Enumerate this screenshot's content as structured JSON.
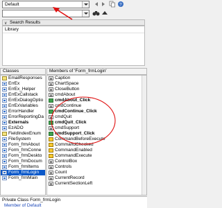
{
  "toolbar": {
    "library_combo_value": "Default",
    "search_combo_value": "",
    "icons": [
      "chevron-left-icon",
      "chevron-right-icon",
      "copy-icon",
      "help-icon",
      "binoculars-icon",
      "collapse-up-icon"
    ]
  },
  "search_results": {
    "title": "Search Results",
    "column_header": "Library"
  },
  "classes_panel": {
    "title": "Classes",
    "items": [
      {
        "label": "EmailResponses",
        "icon": "class-icon"
      },
      {
        "label": "ErrEx",
        "icon": "module-icon"
      },
      {
        "label": "ErrEx_Helper",
        "icon": "module-icon"
      },
      {
        "label": "ErrExCallstack",
        "icon": "module-icon"
      },
      {
        "label": "ErrExDialogOptio",
        "icon": "module-icon"
      },
      {
        "label": "ErrExVariables",
        "icon": "module-icon"
      },
      {
        "label": "ErrorHandler",
        "icon": "module-icon"
      },
      {
        "label": "ErrorReportingDa",
        "icon": "module-icon"
      },
      {
        "label": "Externals",
        "icon": "module-icon",
        "bold": true
      },
      {
        "label": "EzADO",
        "icon": "module-icon"
      },
      {
        "label": "FieldIndexEnum",
        "icon": "enum-icon"
      },
      {
        "label": "FileSystem",
        "icon": "module-icon"
      },
      {
        "label": "Form_frmAbout",
        "icon": "module-icon"
      },
      {
        "label": "Form_frmConne",
        "icon": "module-icon"
      },
      {
        "label": "Form_frmDeskto",
        "icon": "module-icon"
      },
      {
        "label": "Form_frmDocum",
        "icon": "module-icon"
      },
      {
        "label": "Form_frmItems",
        "icon": "module-icon"
      },
      {
        "label": "Form_frmLogin",
        "icon": "module-icon",
        "selected": true
      },
      {
        "label": "Form_frmMain",
        "icon": "module-icon"
      }
    ]
  },
  "members_panel": {
    "title": "Members of 'Form_frmLogin'",
    "items": [
      {
        "label": "Caption",
        "icon": "property-icon"
      },
      {
        "label": "ChartSpace",
        "icon": "property-icon"
      },
      {
        "label": "CloseButton",
        "icon": "property-icon"
      },
      {
        "label": "cmdAbout",
        "icon": "property-icon"
      },
      {
        "label": "cmdAbout_Click",
        "icon": "method-icon",
        "bold": true
      },
      {
        "label": "cmdContinue",
        "icon": "property-icon"
      },
      {
        "label": "cmdContinue_Click",
        "icon": "method-icon",
        "bold": true
      },
      {
        "label": "cmdQuit",
        "icon": "property-icon"
      },
      {
        "label": "cmdQuit_Click",
        "icon": "method-icon",
        "bold": true
      },
      {
        "label": "cmdSupport",
        "icon": "property-icon"
      },
      {
        "label": "cmdSupport_Click",
        "icon": "method-icon",
        "bold": true
      },
      {
        "label": "CommandBeforeExecute",
        "icon": "event-icon"
      },
      {
        "label": "CommandChecked",
        "icon": "event-icon"
      },
      {
        "label": "CommandEnabled",
        "icon": "event-icon"
      },
      {
        "label": "CommandExecute",
        "icon": "event-icon"
      },
      {
        "label": "ControlBox",
        "icon": "property-icon"
      },
      {
        "label": "Controls",
        "icon": "property-icon"
      },
      {
        "label": "Count",
        "icon": "property-icon"
      },
      {
        "label": "CurrentRecord",
        "icon": "property-icon"
      },
      {
        "label": "CurrentSectionLeft",
        "icon": "property-icon"
      }
    ]
  },
  "status_bar": {
    "line1": "Private Class Form_frmLogin",
    "line2": "Member of Default"
  },
  "annotations": {
    "arrow_color": "#e01010",
    "highlight_color": "#e01010"
  }
}
